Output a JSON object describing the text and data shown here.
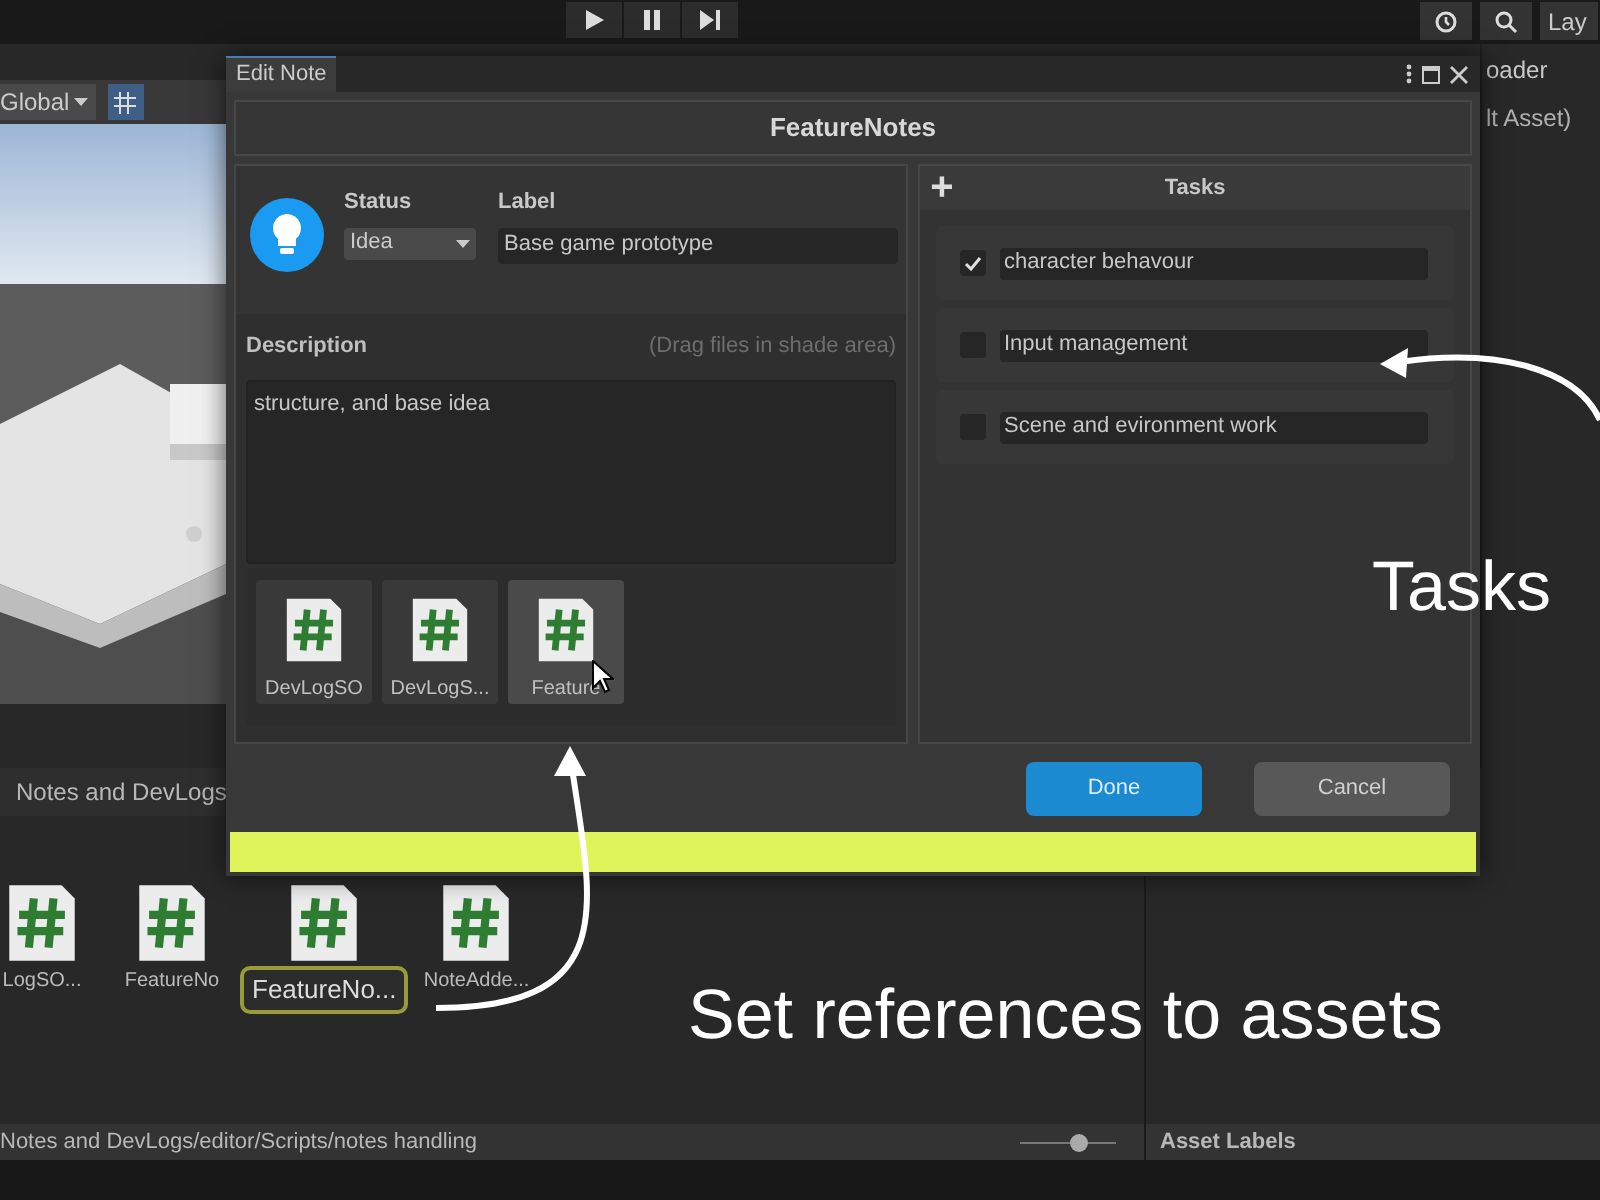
{
  "top_bar": {
    "layout_button": "Lay"
  },
  "scene_view": {
    "pivot_dropdown": "Global"
  },
  "inspector": {
    "title": "oader",
    "subtitle": "lt Asset)"
  },
  "project": {
    "breadcrumb": "Notes and DevLogs",
    "assets": [
      {
        "name": "LogSO...",
        "selected": false
      },
      {
        "name": "FeatureNo",
        "selected": false
      },
      {
        "name": "FeatureNo...",
        "selected": true
      },
      {
        "name": "NoteAdde...",
        "selected": false
      }
    ],
    "path": "Notes and DevLogs/editor/Scripts/notes handling",
    "zoom_slider": {
      "level": 0.6
    },
    "asset_labels": "Asset Labels"
  },
  "dialog": {
    "tab": "Edit Note",
    "title": "FeatureNotes",
    "status_label": "Status",
    "status_value": "Idea",
    "label_label": "Label",
    "label_value": "Base game prototype",
    "description_label": "Description",
    "description_hint": "(Drag files in shade area)",
    "description_value": "structure, and base idea",
    "references": [
      {
        "name": "DevLogSO",
        "hovered": false
      },
      {
        "name": "DevLogS...",
        "hovered": false
      },
      {
        "name": "Feature",
        "hovered": true
      }
    ],
    "tasks": {
      "add_button": "+",
      "title": "Tasks",
      "items": [
        {
          "text": "character behavour",
          "checked": true
        },
        {
          "text": "Input management",
          "checked": false
        },
        {
          "text": "Scene and evironment work",
          "checked": false
        }
      ]
    },
    "buttons": [
      {
        "label": "Done",
        "kind": "primary"
      },
      {
        "label": "Cancel",
        "kind": "secondary"
      }
    ]
  },
  "annotations": [
    {
      "text": "Tasks"
    },
    {
      "text": "Set references to assets"
    }
  ]
}
